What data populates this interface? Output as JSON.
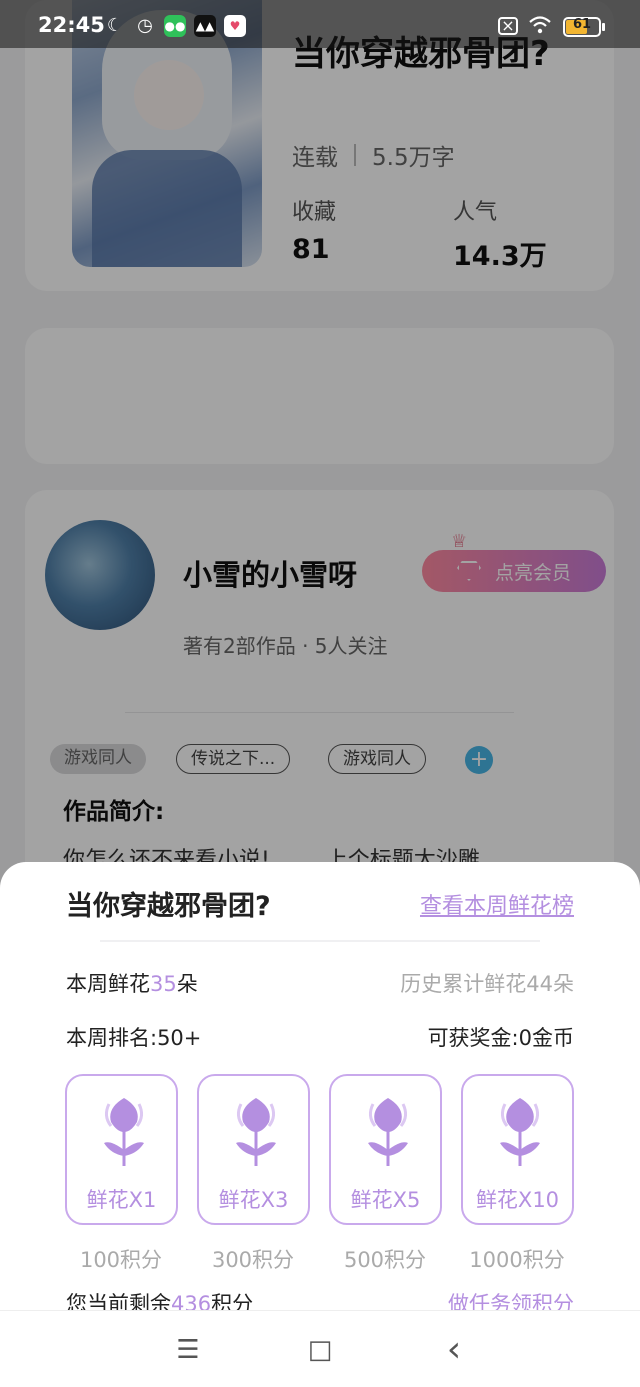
{
  "status_bar": {
    "time": "22:45",
    "battery_level": "61",
    "battery_fraction": 0.61,
    "icons": [
      "moon-icon",
      "alarm-icon",
      "wechat-icon",
      "app-icon",
      "app-icon",
      "sim-x-icon",
      "wifi-icon",
      "battery-icon"
    ]
  },
  "book": {
    "title": "当你穿越邪骨团?",
    "status": "连载",
    "word_count": "5.5万字",
    "favorites_label": "收藏",
    "favorites_value": "81",
    "popularity_label": "人气",
    "popularity_value": "14.3万"
  },
  "author": {
    "name": "小雪的小雪呀",
    "stats": "著有2部作品 · 5人关注",
    "vip_button": "点亮会员"
  },
  "tags": [
    "游戏同人",
    "传说之下...",
    "游戏同人"
  ],
  "intro": {
    "title": "作品简介:",
    "text": "你怎么还不来看小说!        上个标题太沙雕"
  },
  "sheet": {
    "title": "当你穿越邪骨团?",
    "rank_link": "查看本周鲜花榜",
    "week_flowers_prefix": "本周鲜花",
    "week_flowers_count": "35",
    "week_flowers_suffix": "朵",
    "total_flowers": "历史累计鲜花44朵",
    "week_rank": "本周排名:50+",
    "reward": "可获奖金:0金币",
    "options": [
      {
        "label": "鲜花X1",
        "price": "100积分"
      },
      {
        "label": "鲜花X3",
        "price": "300积分"
      },
      {
        "label": "鲜花X5",
        "price": "500积分"
      },
      {
        "label": "鲜花X10",
        "price": "1000积分"
      }
    ],
    "remain_prefix": "您当前剩余",
    "remain_points": "436",
    "remain_suffix": "积分",
    "task_link": "做任务领积分"
  },
  "nav": {
    "menu_icon": "☰",
    "home_icon": "□",
    "back_icon": "‹"
  },
  "colors": {
    "accent": "#b48fe0",
    "vip_start": "#ff8aa0",
    "vip_end": "#c97bd8",
    "plus": "#49b6e6"
  }
}
